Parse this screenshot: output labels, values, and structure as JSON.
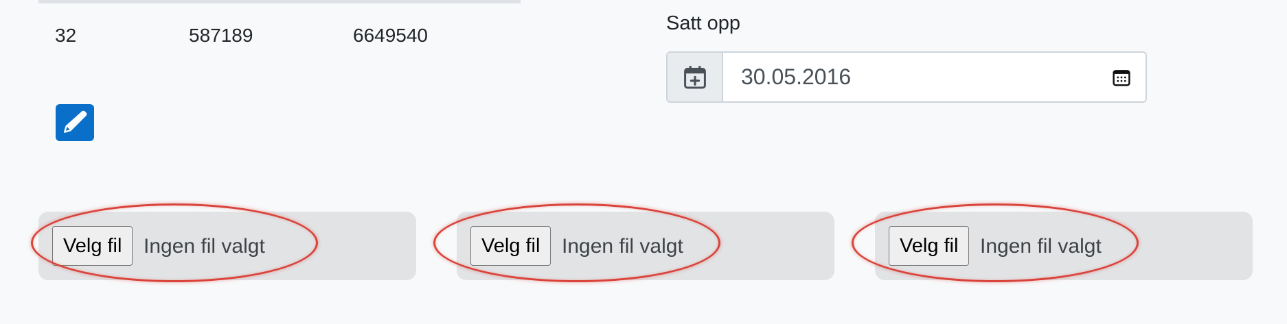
{
  "table_row": {
    "cells": [
      "32",
      "587189",
      "6649540"
    ]
  },
  "edit_button": {
    "icon": "pencil-icon",
    "color": "#0a6fc9"
  },
  "date_field": {
    "label": "Satt opp",
    "value": "30.05.2016",
    "prefix_icon": "calendar-plus-icon",
    "picker_icon": "calendar-icon"
  },
  "file_inputs": [
    {
      "button_label": "Velg fil",
      "status": "Ingen fil valgt"
    },
    {
      "button_label": "Velg fil",
      "status": "Ingen fil valgt"
    },
    {
      "button_label": "Velg fil",
      "status": "Ingen fil valgt"
    }
  ],
  "highlight_color": "#d9433a"
}
